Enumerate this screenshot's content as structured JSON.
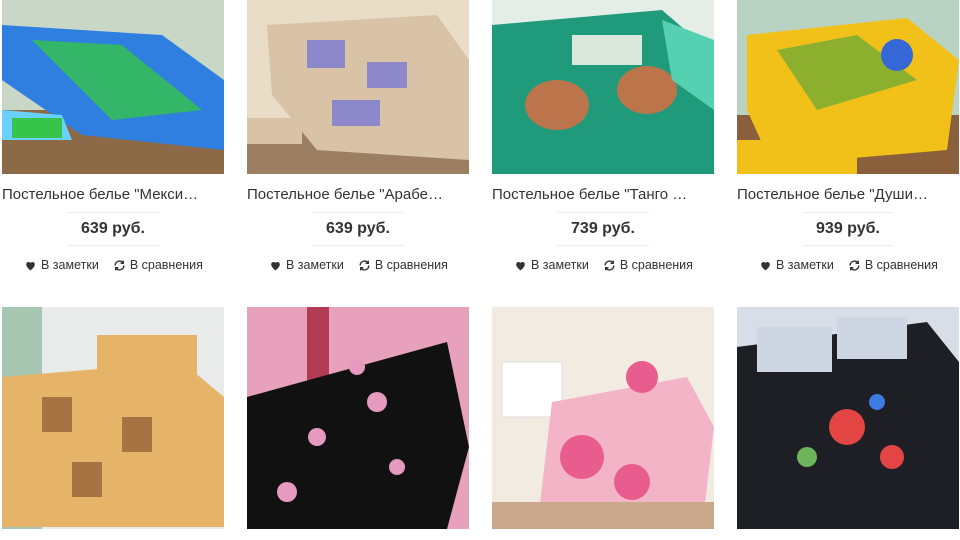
{
  "products": [
    {
      "title": "Постельное белье \"Мекси…",
      "price": "639 руб.",
      "note_label": "В заметки",
      "compare_label": "В сравнения",
      "colors": {
        "bg": "#c9d8c6",
        "main": "#2f7fe0",
        "accent": "#36c44a"
      }
    },
    {
      "title": "Постельное белье \"Арабе…",
      "price": "639 руб.",
      "note_label": "В заметки",
      "compare_label": "В сравнения",
      "colors": {
        "bg": "#e9ddc8",
        "main": "#d8c3a6",
        "accent": "#8c88c9"
      }
    },
    {
      "title": "Постельное белье \"Танго …",
      "price": "739 руб.",
      "note_label": "В заметки",
      "compare_label": "В сравнения",
      "colors": {
        "bg": "#e5ede7",
        "main": "#1f9b7c",
        "accent": "#d86f43"
      }
    },
    {
      "title": "Постельное белье \"Души…",
      "price": "939 руб.",
      "note_label": "В заметки",
      "compare_label": "В сравнения",
      "colors": {
        "bg": "#b9d3c2",
        "main": "#f1c11a",
        "accent": "#49a43b"
      }
    },
    {
      "title": "",
      "price": "",
      "note_label": "",
      "compare_label": "",
      "colors": {
        "bg": "#e8ebe9",
        "main": "#e6b469",
        "accent": "#7a4a28"
      }
    },
    {
      "title": "",
      "price": "",
      "note_label": "",
      "compare_label": "",
      "colors": {
        "bg": "#e7a1bb",
        "main": "#111111",
        "accent": "#e79ac0"
      }
    },
    {
      "title": "",
      "price": "",
      "note_label": "",
      "compare_label": "",
      "colors": {
        "bg": "#f2ebe1",
        "main": "#f4b4c7",
        "accent": "#e85d8e"
      }
    },
    {
      "title": "",
      "price": "",
      "note_label": "",
      "compare_label": "",
      "colors": {
        "bg": "#d7dee8",
        "main": "#1e1f24",
        "accent": "#e34545"
      }
    }
  ],
  "icons": {
    "note": "heart-icon",
    "compare": "refresh-icon"
  }
}
